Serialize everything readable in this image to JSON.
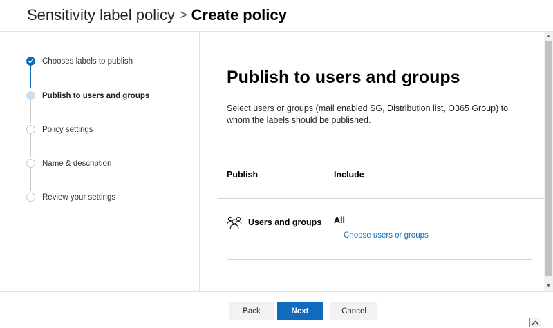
{
  "header": {
    "breadcrumb_parent": "Sensitivity label policy",
    "separator": ">",
    "breadcrumb_current": "Create policy"
  },
  "wizard": {
    "steps": [
      {
        "label": "Chooses labels to publish",
        "state": "done"
      },
      {
        "label": "Publish to users and groups",
        "state": "current"
      },
      {
        "label": "Policy settings",
        "state": "pending"
      },
      {
        "label": "Name & description",
        "state": "pending"
      },
      {
        "label": "Review your settings",
        "state": "pending"
      }
    ]
  },
  "main": {
    "title": "Publish to users and groups",
    "description": "Select users or groups (mail enabled SG, Distribution list, O365 Group) to whom the labels should be published.",
    "columns": {
      "publish": "Publish",
      "include": "Include"
    },
    "row": {
      "icon": "people-icon",
      "label": "Users and groups",
      "value": "All",
      "link": "Choose users or groups"
    }
  },
  "footer": {
    "back": "Back",
    "next": "Next",
    "cancel": "Cancel"
  },
  "colors": {
    "accent": "#0f6cbd",
    "current_step": "#c7e0f4",
    "pending_step": "#c8c8c8"
  }
}
